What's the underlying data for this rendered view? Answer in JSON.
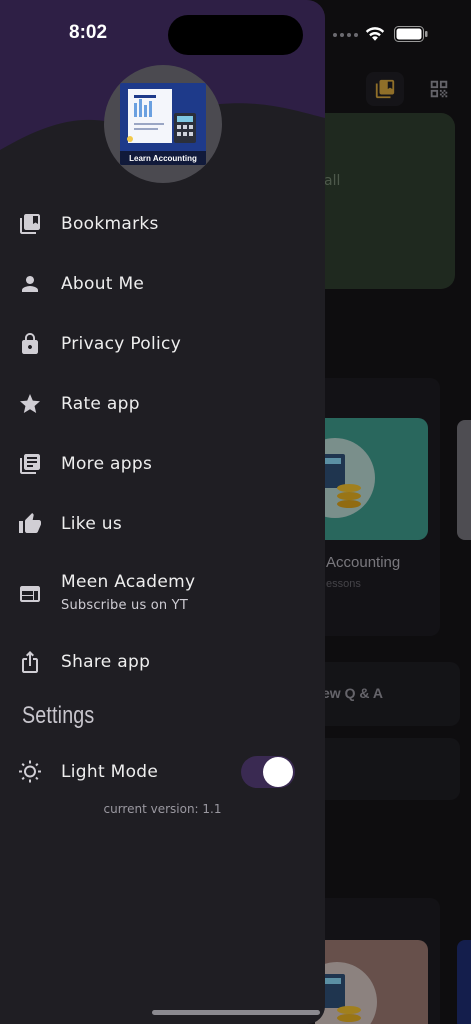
{
  "status_bar": {
    "time": "8:02"
  },
  "app_logo": {
    "label": "Learn Accounting"
  },
  "menu": [
    {
      "id": "bookmarks",
      "label": "Bookmarks",
      "icon": "bookmarks-icon"
    },
    {
      "id": "about",
      "label": "About Me",
      "icon": "person-icon"
    },
    {
      "id": "privacy",
      "label": "Privacy Policy",
      "icon": "lock-icon"
    },
    {
      "id": "rate",
      "label": "Rate app",
      "icon": "star-icon"
    },
    {
      "id": "more",
      "label": "More apps",
      "icon": "library-icon"
    },
    {
      "id": "like",
      "label": "Like us",
      "icon": "thumb-up-icon"
    },
    {
      "id": "academy",
      "label": "Meen Academy",
      "sub": "Subscribe us on YT",
      "icon": "web-icon"
    },
    {
      "id": "share",
      "label": "Share app",
      "icon": "share-icon"
    }
  ],
  "settings": {
    "title": "Settings",
    "light_mode_label": "Light Mode",
    "light_mode_on": true,
    "version": "current version: 1.1"
  },
  "background": {
    "banner_text": "all",
    "card_title": "Accounting",
    "card_subtitle": "essons",
    "qa_text": "ew Q & A"
  },
  "colors": {
    "drawer_bg": "#1f1e23",
    "header_purple": "#2e1f45",
    "toggle_track": "#3a2a52"
  }
}
